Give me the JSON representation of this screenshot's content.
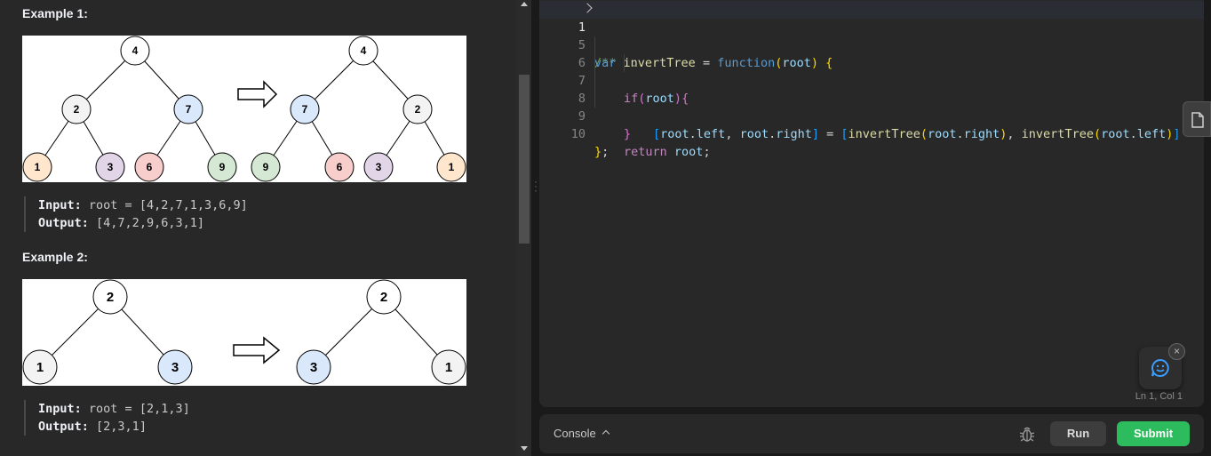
{
  "examples": [
    {
      "heading": "Example 1:",
      "input_label": "Input:",
      "input_value": "root = [4,2,7,1,3,6,9]",
      "output_label": "Output:",
      "output_value": "[4,7,2,9,6,3,1]",
      "tree_before": [
        "4",
        "2",
        "7",
        "1",
        "3",
        "6",
        "9"
      ],
      "tree_after": [
        "4",
        "7",
        "2",
        "9",
        "6",
        "3",
        "1"
      ]
    },
    {
      "heading": "Example 2:",
      "input_label": "Input:",
      "input_value": "root = [2,1,3]",
      "output_label": "Output:",
      "output_value": "[2,3,1]",
      "tree_before": [
        "2",
        "1",
        "3"
      ],
      "tree_after": [
        "2",
        "3",
        "1"
      ]
    }
  ],
  "node_colors": {
    "root": "#ffffff",
    "gray": "#f3f3f3",
    "blue": "#dae8fc",
    "orange": "#ffe6cc",
    "purple": "#e1d5e7",
    "red": "#f8cecc",
    "green": "#d5e8d4"
  },
  "editor": {
    "lines": [
      {
        "num": "1",
        "text": "/** ..."
      },
      {
        "num": "5",
        "text": "var invertTree = function(root) {"
      },
      {
        "num": "6",
        "text": "if(root){"
      },
      {
        "num": "7",
        "text": "[root.left, root.right] = [invertTree(root.right), invertTree(root.left)]"
      },
      {
        "num": "8",
        "text": "}"
      },
      {
        "num": "9",
        "text": "return root;"
      },
      {
        "num": "10",
        "text": "};"
      }
    ],
    "cursor_position": "Ln 1, Col 1",
    "side_button_icon": "file-icon",
    "chat_icon": "chat-smile-icon",
    "chat_close_label": "×"
  },
  "console": {
    "label": "Console",
    "debug_icon": "bug-icon",
    "run_label": "Run",
    "submit_label": "Submit",
    "submit_color": "#2cbb5d"
  }
}
